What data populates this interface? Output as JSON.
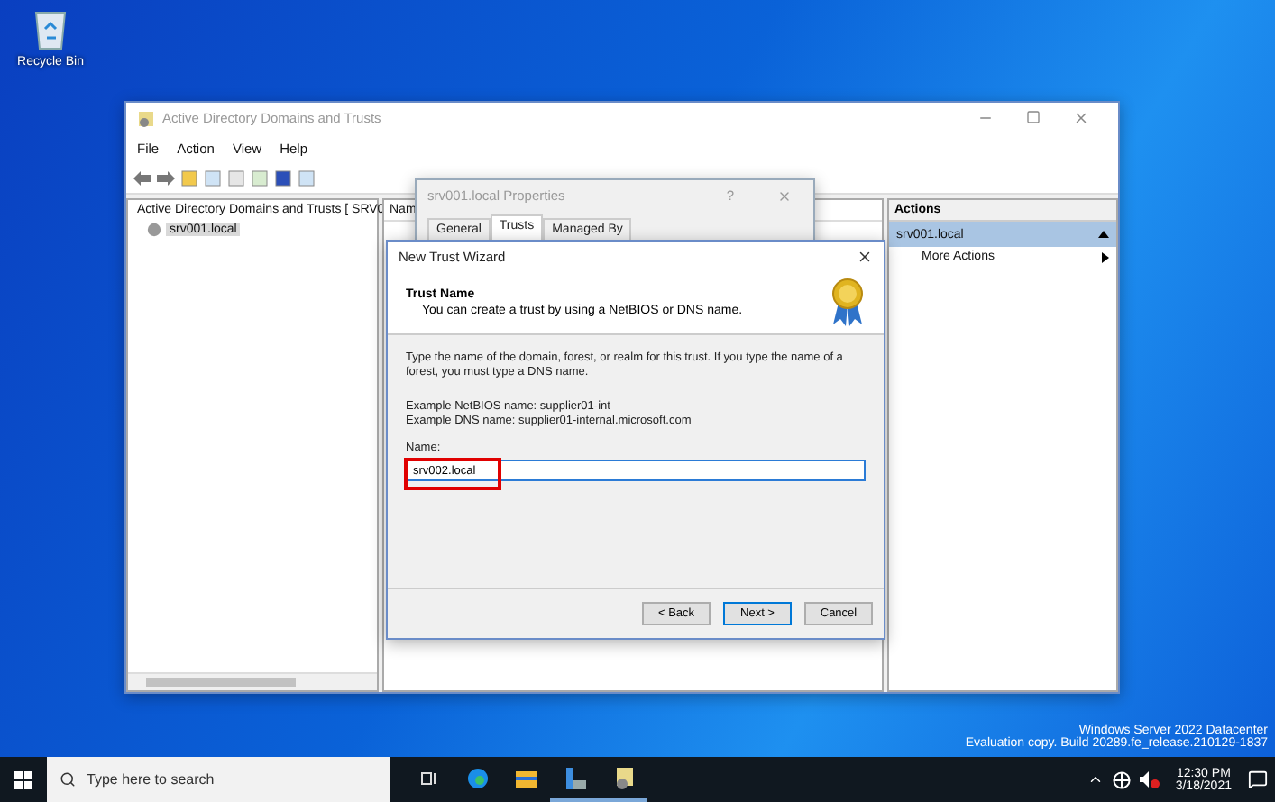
{
  "desktop": {
    "icons": [
      {
        "label": "Recycle Bin"
      }
    ]
  },
  "mmc": {
    "title": "Active Directory Domains and Trusts",
    "menu": [
      "File",
      "Action",
      "View",
      "Help"
    ],
    "tree": {
      "root": "Active Directory Domains and Trusts [ SRV0",
      "children": [
        {
          "label": "srv001.local",
          "selected": true
        }
      ]
    },
    "center": {
      "column_1": "Nam"
    },
    "actions": {
      "header": "Actions",
      "section": "srv001.local",
      "items": [
        {
          "label": "More Actions"
        }
      ]
    }
  },
  "properties_dialog": {
    "title": "srv001.local Properties",
    "help": "?",
    "tabs": [
      {
        "label": "General",
        "selected": false
      },
      {
        "label": "Trusts",
        "selected": true
      },
      {
        "label": "Managed By",
        "selected": false
      }
    ]
  },
  "wizard": {
    "title": "New Trust Wizard",
    "heading": "Trust Name",
    "subheading": "You can create a trust by using a NetBIOS or DNS name.",
    "instructions": "Type the name of the domain, forest, or realm for this trust. If you type the name of a forest, you must type a DNS name.",
    "examples": [
      "Example NetBIOS name: supplier01-int",
      "Example DNS name: supplier01-internal.microsoft.com"
    ],
    "name_label": "Name:",
    "name_value": "srv002.local",
    "name_highlighted": true,
    "buttons": [
      {
        "label": "< Back",
        "default": false
      },
      {
        "label": "Next >",
        "default": true
      },
      {
        "label": "Cancel",
        "default": false
      }
    ]
  },
  "os_notice": [
    "Windows Server 2022 Datacenter",
    "Evaluation copy. Build 20289.fe_release.210129-1837"
  ],
  "taskbar": {
    "search_placeholder": "Type here to search",
    "apps": [
      {
        "kind": "taskview",
        "running": false
      },
      {
        "kind": "edge",
        "running": false
      },
      {
        "kind": "explorer",
        "running": false
      },
      {
        "kind": "server",
        "running": true
      },
      {
        "kind": "domains",
        "running": true
      }
    ],
    "clock": {
      "time": "12:30 PM",
      "date": "3/18/2021"
    }
  }
}
